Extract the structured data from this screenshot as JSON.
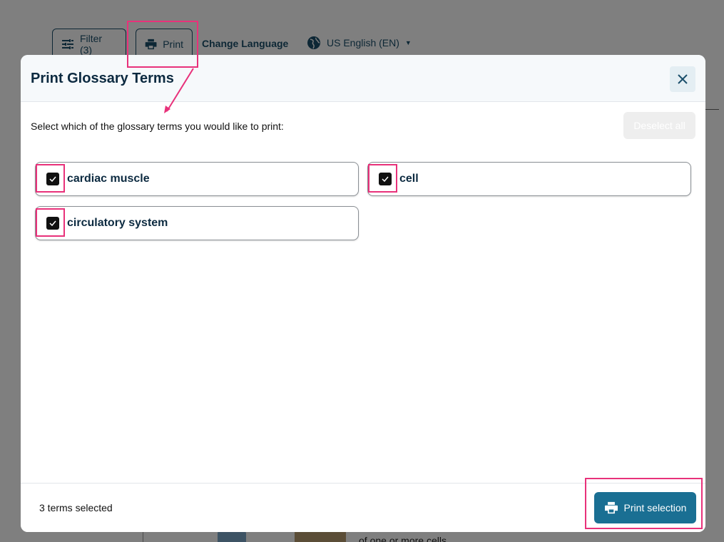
{
  "background": {
    "filter_label": "Filter (3)",
    "print_label": "Print",
    "change_language_label": "Change Language",
    "language_value": "US English (EN)",
    "bottom_text": "of one or more cells"
  },
  "modal": {
    "title": "Print Glossary Terms",
    "instruction": "Select which of the glossary terms you would like to print:",
    "deselect_label": "Deselect all",
    "terms": [
      {
        "label": "cardiac muscle",
        "checked": true
      },
      {
        "label": "cell",
        "checked": true
      },
      {
        "label": "circulatory system",
        "checked": true
      }
    ],
    "footer": {
      "count_text": "3 terms selected",
      "print_selection_label": "Print selection"
    }
  },
  "colors": {
    "primary": "#1a6f93",
    "title_text": "#0c2a40",
    "highlight": "#e8317a"
  }
}
